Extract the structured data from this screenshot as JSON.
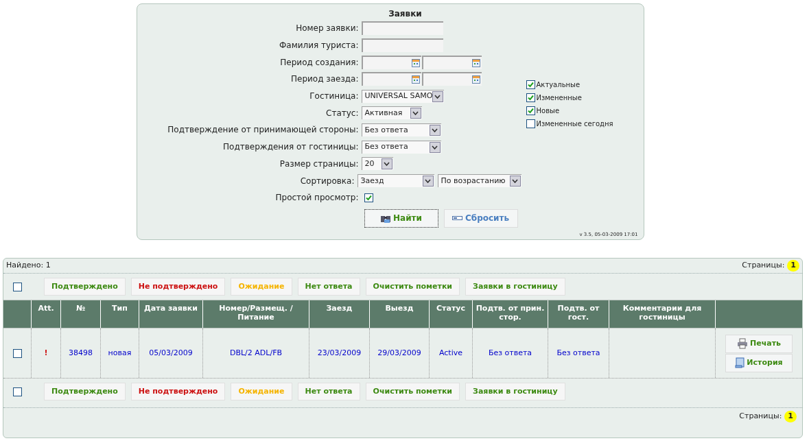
{
  "filter": {
    "title": "Заявки",
    "fields": [
      {
        "kind": "text",
        "label": "Номер заявки:"
      },
      {
        "kind": "text",
        "label": "Фамилия туриста:"
      },
      {
        "kind": "date_range",
        "label": "Период создания:"
      },
      {
        "kind": "date_range",
        "label": "Период заезда:"
      },
      {
        "kind": "select",
        "label": "Гостиница:",
        "value": "UNIVERSAL SAMO"
      },
      {
        "kind": "select",
        "label": "Статус:",
        "value": "Активная"
      },
      {
        "kind": "select",
        "label": "Подтверждение от принимающей стороны:",
        "value": "Без ответа"
      },
      {
        "kind": "select",
        "label": "Подтверждения от гостиницы:",
        "value": "Без ответа"
      },
      {
        "kind": "select",
        "label": "Размер страницы:",
        "value": "20"
      },
      {
        "kind": "select_pair",
        "label": "Сортировка:",
        "value": "Заезд",
        "value2": "По возрастанию"
      },
      {
        "kind": "checkbox",
        "label": "Простой просмотр:",
        "checked": true
      }
    ],
    "flags": [
      {
        "label": "Актуальные",
        "checked": true
      },
      {
        "label": "Измененные",
        "checked": true
      },
      {
        "label": "Новые",
        "checked": true
      },
      {
        "label": "Измененные сегодня",
        "checked": false
      }
    ],
    "buttons": [
      {
        "label": "Найти",
        "kind": "search",
        "focused": true
      },
      {
        "label": "Сбросить",
        "kind": "reset",
        "focused": false
      }
    ],
    "version": "v 3.5, 05-03-2009 17:01"
  },
  "results": {
    "found": "Найдено: 1",
    "pages_label": "Страницы:",
    "pages": [
      {
        "label": "1",
        "selected": true
      }
    ],
    "select_all_top": false,
    "select_all_bottom": false,
    "actions_top": [
      {
        "label": "Подтверждено",
        "color": "#3d8a12"
      },
      {
        "label": "Не подтверждено",
        "color": "#cc1111"
      },
      {
        "label": "Ожидание",
        "color": "#f5b400"
      },
      {
        "label": "Нет ответа",
        "color": "#3d8a12"
      },
      {
        "label": "Очистить пометки",
        "color": "#3d8a12"
      },
      {
        "label": "Заявки в гостиницу",
        "color": "#3d8a12"
      }
    ],
    "columns": [
      "Att.",
      "№",
      "Тип",
      "Дата заявки",
      "Номер/Размещ. /Питание",
      "Заезд",
      "Выезд",
      "Статус",
      "Подтв. от прин. стор.",
      "Подтв. от гост.",
      "Комментарии для гостиницы"
    ],
    "rows": [
      {
        "checked": false,
        "cells": [
          "!",
          "38498",
          "новая",
          "05/03/2009",
          "DBL/2 ADL/FB",
          "23/03/2009",
          "29/03/2009",
          "Active",
          "Без ответа",
          "Без ответа",
          ""
        ],
        "buttons": [
          {
            "label": "Печать",
            "kind": "print"
          },
          {
            "label": "История",
            "kind": "history"
          }
        ]
      }
    ],
    "actions_bottom": [
      {
        "label": "Подтверждено",
        "color": "#3d8a12"
      },
      {
        "label": "Не подтверждено",
        "color": "#cc1111"
      },
      {
        "label": "Ожидание",
        "color": "#f5b400"
      },
      {
        "label": "Нет ответа",
        "color": "#3d8a12"
      },
      {
        "label": "Очистить пометки",
        "color": "#3d8a12"
      },
      {
        "label": "Заявки в гостиницу",
        "color": "#3d8a12"
      }
    ],
    "pages_label_bottom": "Страницы:",
    "pages_bottom": [
      {
        "label": "1",
        "selected": true
      }
    ]
  }
}
